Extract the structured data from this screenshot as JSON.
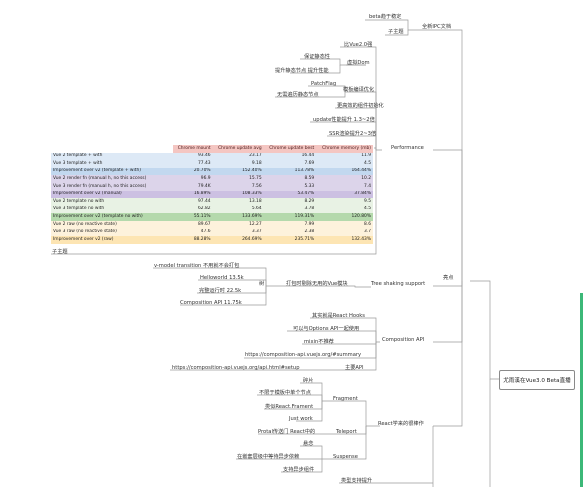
{
  "root": "尤雨溪在Vue3.0 Beta直播",
  "nodes": {
    "n_ipc": "全新IPC文档",
    "n_beta": "beta趋于稳定",
    "n_zhuti": "子主题",
    "n_why": "比Vue2.0强",
    "n_diff": "保证静态性",
    "n_vdom": "虚拟Dom",
    "n_tpl": "提升静态节点 提升性能",
    "n_patch": "PatchFlag",
    "n_tmpl_opt": "模板编译优化",
    "n_static": "无需遍历静态节点",
    "n_gzip": "更高效的组件初始化",
    "n_update": "update性能提升 1.3~2倍",
    "n_ssr": "SSR渲染提升2~3倍",
    "n_perf": "Performance",
    "n_zhuti2": "子主题",
    "n_vmodel": "v-model transition 不用就不会打包",
    "n_hello": "Helloworld 13.5k",
    "n_full": "完整运行时 22.5k",
    "n_comp_size": "Composition API 11.75k",
    "n_ts_small": "树",
    "n_packaging": "打包时剔除无用的Vue模块",
    "n_tree": "Tree shaking support",
    "n_hl": "亮点",
    "n_react_hooks": "其实就是React Hooks",
    "n_options": "可以与Options API一起使用",
    "n_mixin": "mixin不推荐",
    "n_url1": "https://composition-api.vuejs.org/#summary",
    "n_comp_api": "Composition API",
    "n_url2": "https://composition-api.vuejs.org/api.html#setup",
    "n_mainapi": "主要API",
    "n_frag_c": "碎片",
    "n_frag_1": "不限于模板中单个节点",
    "n_frag_2": "类似React.Frament",
    "n_fragment": "Fragment",
    "n_just": "Just work",
    "n_portal": "Protal传送门 React中的",
    "n_teleport": "Teleport",
    "n_react": "React学来的很棒作",
    "n_susp_1": "悬念",
    "n_susp_2": "在嵌套层级中等待异步依赖",
    "n_suspense": "Suspense",
    "n_async": "支持异步组件",
    "n_ts": "类型支持提升"
  },
  "table": {
    "columns": [
      "",
      "Chrome mount",
      "Chrome update avg",
      "Chrome update best",
      "Chrome memory (mb)"
    ],
    "rows": [
      {
        "name": "Vue 2 template + with",
        "v": [
          "93.46",
          "23.17",
          "16.44",
          "11.9"
        ],
        "color": "#dde9f6"
      },
      {
        "name": "Vue 3 template + with",
        "v": [
          "77.43",
          "9.18",
          "7.69",
          "4.5"
        ],
        "color": "#dde9f6"
      },
      {
        "name": "Improvement over v2 (template + with)",
        "v": [
          "20.70%",
          "152.40%",
          "113.78%",
          "164.44%"
        ],
        "color": "#c2d8ef"
      },
      {
        "name": "Vue 2 render fn (manual h, no this access)",
        "v": [
          "96.9",
          "15.75",
          "8.59",
          "10.2"
        ],
        "color": "#dcd4ea"
      },
      {
        "name": "Vue 3 render fn (manual h, no this access)",
        "v": [
          "79.4K",
          "7.56",
          "5.33",
          "7.4"
        ],
        "color": "#dcd4ea"
      },
      {
        "name": "Improvement over v2 (manual)",
        "v": [
          "16.89%",
          "108.33%",
          "53.47%",
          "37.84%"
        ],
        "color": "#ccc0e2"
      },
      {
        "name": "Vue 2 template no with",
        "v": [
          "97.44",
          "13.18",
          "8.29",
          "9.5"
        ],
        "color": "#e8f2e4"
      },
      {
        "name": "Vue 3 template no with",
        "v": [
          "62.82",
          "5.64",
          "3.78",
          "4.5"
        ],
        "color": "#e8f2e4"
      },
      {
        "name": "Improvement over v2 (template no with)",
        "v": [
          "55.11%",
          "133.69%",
          "119.31%",
          "120.80%"
        ],
        "color": "#b4d9ac"
      },
      {
        "name": "Vue 2 raw (no reactive state)",
        "v": [
          "89.67",
          "12.27",
          "7.99",
          "8.6"
        ],
        "color": "#fdf2dc"
      },
      {
        "name": "Vue 3 raw (no reactive state)",
        "v": [
          "47.6",
          "3.37",
          "2.38",
          "3.7"
        ],
        "color": "#fdf2dc"
      },
      {
        "name": "Improvement over v2 (raw)",
        "v": [
          "88.28%",
          "264.69%",
          "235.71%",
          "132.43%"
        ],
        "color": "#fde5b3"
      }
    ]
  }
}
